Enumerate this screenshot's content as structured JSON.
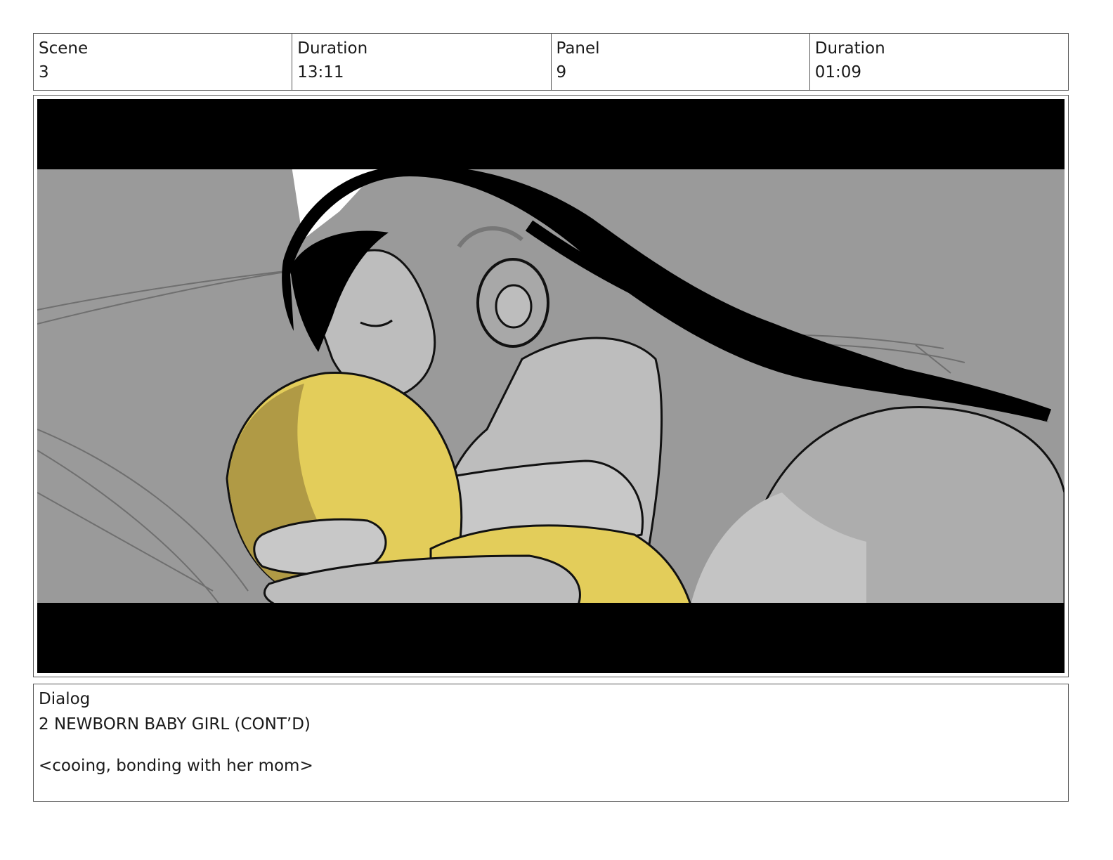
{
  "header": {
    "scene_label": "Scene",
    "scene_value": "3",
    "scene_duration_label": "Duration",
    "scene_duration_value": "13:11",
    "panel_label": "Panel",
    "panel_value": "9",
    "panel_duration_label": "Duration",
    "panel_duration_value": "01:09"
  },
  "dialog": {
    "label": "Dialog",
    "speaker": "2 NEWBORN BABY GIRL (CONT’D)",
    "line": "<cooing, bonding with her mom>"
  },
  "colors": {
    "letterbox": "#000000",
    "background_gray": "#9a9a9a",
    "skin_gray": "#bdbdbd",
    "baby_yellow": "#e3cd5a",
    "hair_black": "#000000"
  }
}
